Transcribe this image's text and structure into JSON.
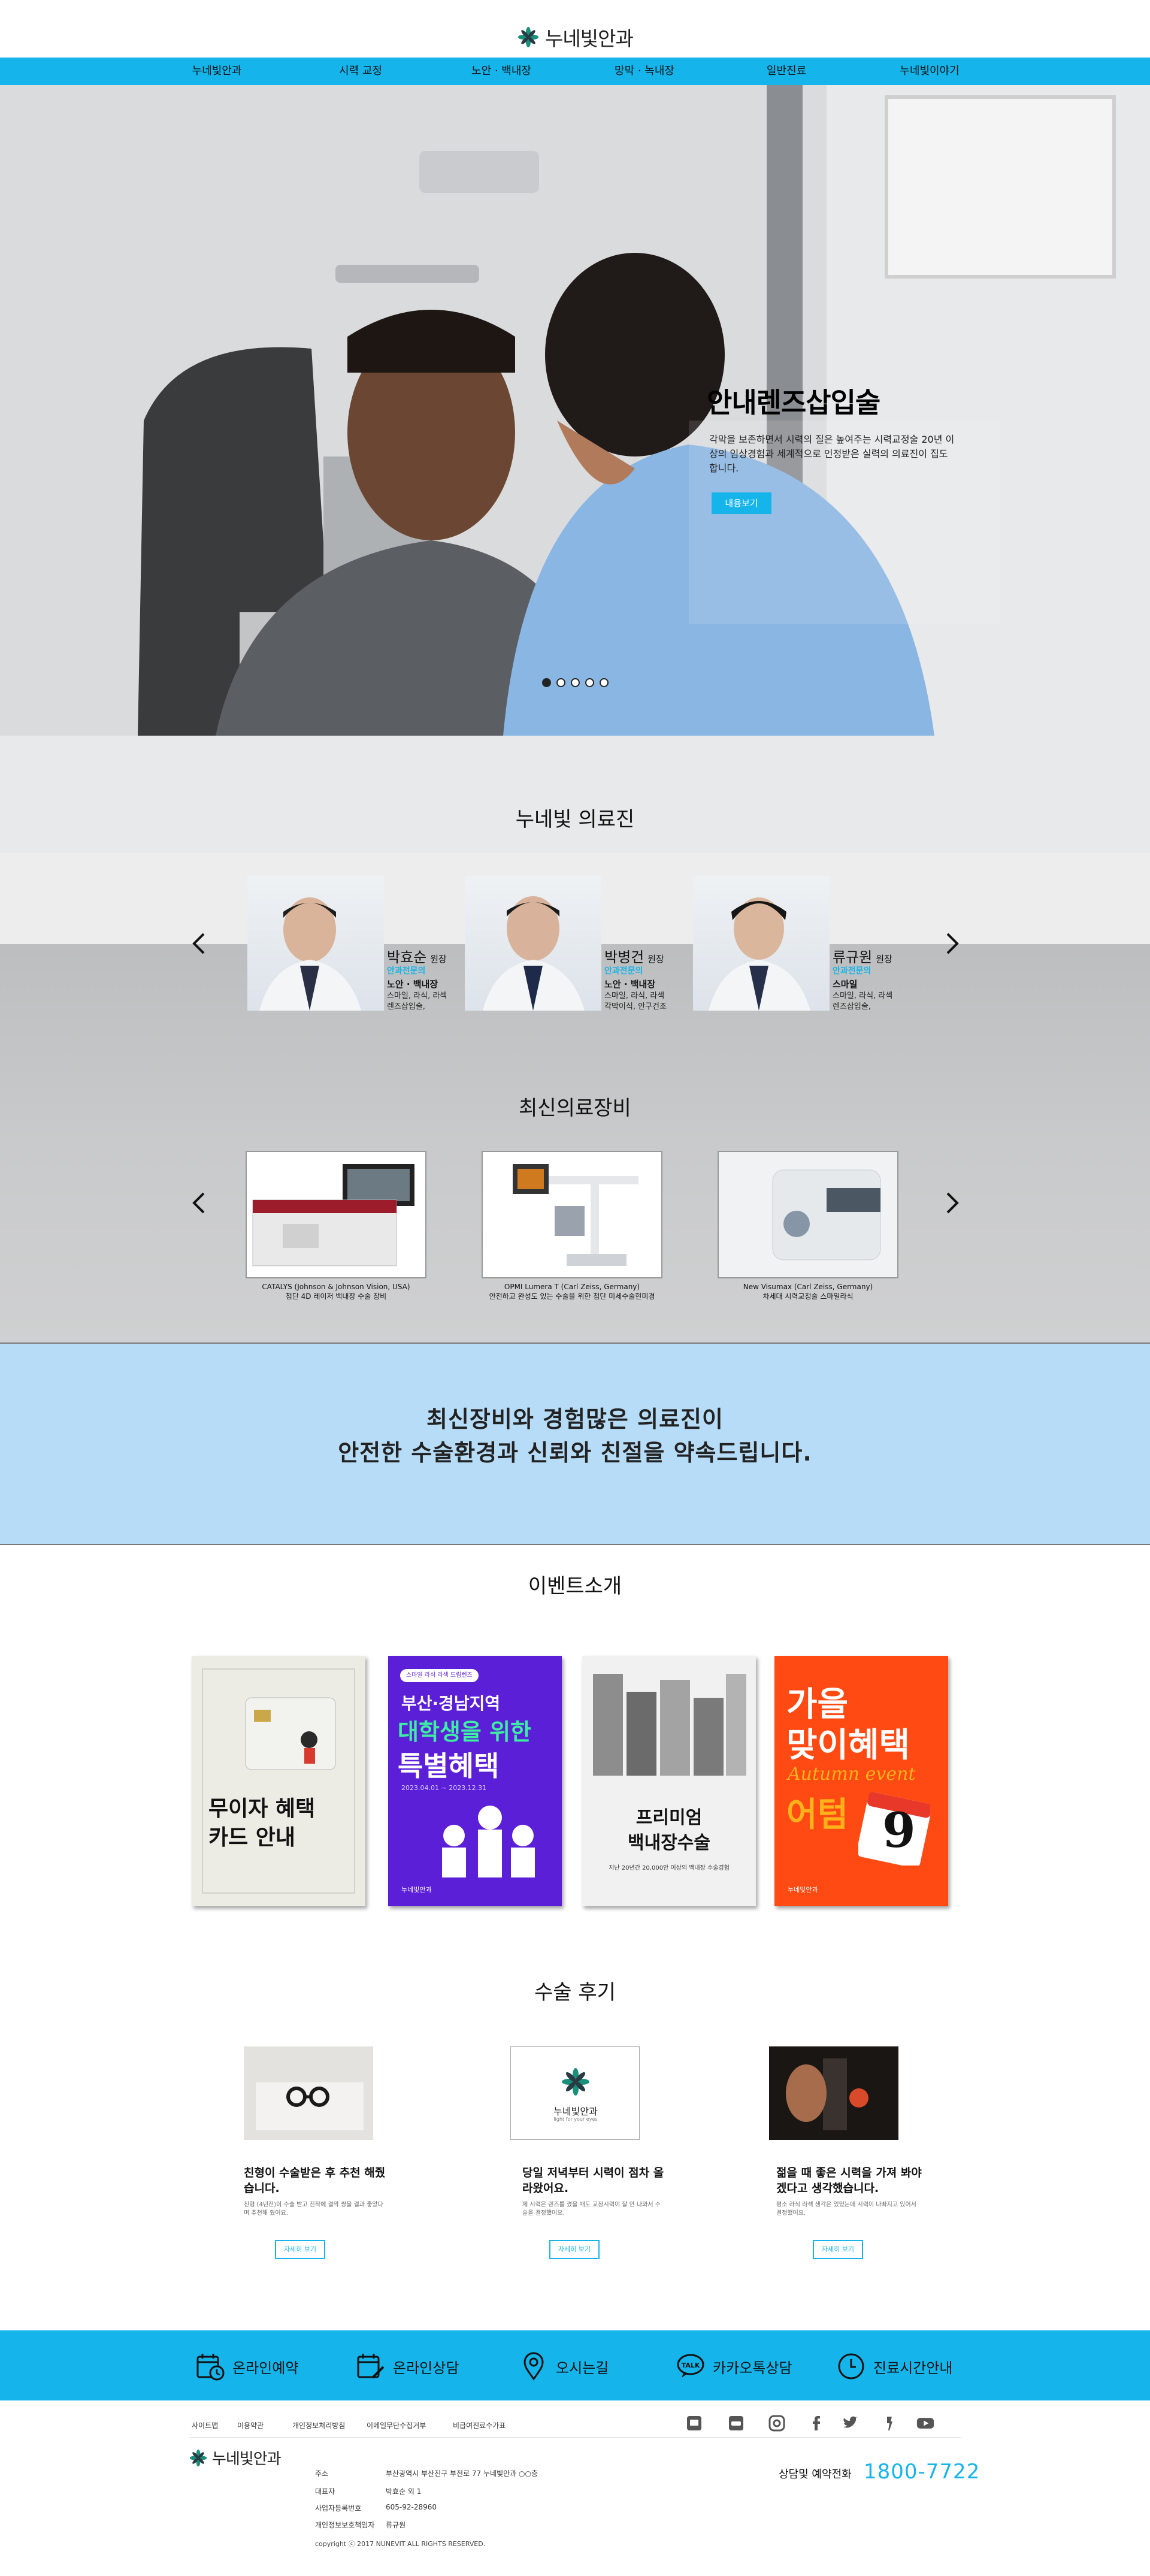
{
  "brand": {
    "name": "누네빛안과",
    "tagline": "light for your eyes",
    "accent": "#15b4ea"
  },
  "nav": [
    "누네빛안과",
    "시력 교정",
    "노안 · 백내장",
    "망막 · 녹내장",
    "일반진료",
    "누네빛이야기"
  ],
  "hero": {
    "title": "안내렌즈삽입술",
    "description": "각막을 보존하면서 시력의 질은 높여주는 시력교정술 20년 이상의 임상경험과 세계적으로 인정받은 실력의 의료진이 집도합니다.",
    "button": "내용보기",
    "slides": 5,
    "active_slide": 1
  },
  "doctors": {
    "title": "누네빛 의료진",
    "items": [
      {
        "name": "박효순",
        "role": "원장",
        "tag": "안과전문의",
        "spec": "노안 · 백내장",
        "desc": "스마일, 라식, 라섹 렌즈삽입술,"
      },
      {
        "name": "박병건",
        "role": "원장",
        "tag": "안과전문의",
        "spec": "노안 · 백내장",
        "desc": "스마일, 라식, 라섹 각막이식, 안구건조"
      },
      {
        "name": "류규원",
        "role": "원장",
        "tag": "안과전문의",
        "spec": "스마일",
        "desc": "스마일, 라식, 라섹 렌즈삽입술,"
      }
    ]
  },
  "equipment": {
    "title": "최신의료장비",
    "items": [
      {
        "name": "CATALYS (Johnson & Johnson Vision, USA)",
        "caption": "첨단 4D 레이저 백내장 수술 장비"
      },
      {
        "name": "OPMI Lumera T (Carl Zeiss, Germany)",
        "caption": "안전하고 완성도 있는 수술을 위한 첨단 미세수술현미경"
      },
      {
        "name": "New Visumax (Carl Zeiss, Germany)",
        "caption": "차세대 시력교정술 스마일라식"
      }
    ]
  },
  "banner": {
    "line1": "최신장비와 경험많은 의료진이",
    "line2": "안전한 수술환경과 신뢰와 친절을 약속드립니다."
  },
  "events": {
    "title": "이벤트소개",
    "cards": [
      {
        "title_line1": "무이자 혜택",
        "title_line2": "카드 안내"
      },
      {
        "top_badge": "스마일 라식 라섹 드림렌즈",
        "line1": "부산·경남지역",
        "line2": "대학생을 위한",
        "line3": "특별혜택",
        "period": "2023.04.01 ~ 2023.12.31",
        "logo": "누네빛안과"
      },
      {
        "line1": "프리미엄",
        "line2": "백내장수술",
        "note": "지난 20년간 20,000안 이상의 백내장 수술경험"
      },
      {
        "line1": "가을",
        "line2": "맞이혜택",
        "script": "Autumn event",
        "line3": "어텀",
        "big_num": "9",
        "logo": "누네빛안과"
      }
    ]
  },
  "reviews": {
    "title": "수술 후기",
    "button": "자세히 보기",
    "items": [
      {
        "head": "친형이 수술받은 후 추천 해줬습니다.",
        "body": "친형 (4년전)이 수술 받고 진작에 결막 쌍을 결과 좋았다며 추천해 줬어요."
      },
      {
        "head": "당일 저녁부터 시력이 점차 올라왔어요.",
        "body": "제 시력은 렌즈를 꼈을 때도 교정시력이 잘 안 나와서 수술을 결정했어요."
      },
      {
        "head": "젊을 때 좋은 시력을 가져 봐야겠다고 생각했습니다.",
        "body": "평소 라식 라섹 생각은 있었는데 시력이 나빠지고 있어서 결정했어요."
      }
    ]
  },
  "quick_links": [
    "온라인예약",
    "온라인상담",
    "오시는길",
    "카카오톡상담",
    "진료시간안내"
  ],
  "footer": {
    "links": [
      "사이트맵",
      "이용약관",
      "개인정보처리방침",
      "이메일무단수집거부",
      "비급여진료수가표"
    ],
    "info": [
      {
        "k": "주소",
        "v": "부산광역시 부산진구 부전로 77 누네빛안과 ○○층"
      },
      {
        "k": "대표자",
        "v": "박효순 외 1"
      },
      {
        "k": "사업자등록번호",
        "v": "605-92-28960"
      },
      {
        "k": "개인정보보호책임자",
        "v": "류규원"
      }
    ],
    "copyright": "copyright ⓒ 2017 NUNEVIT ALL RIGHTS RESERVED.",
    "phone_label": "상담및 예약전화",
    "phone": "1800-7722",
    "social_icons": [
      "blog-icon",
      "cafe-icon",
      "instagram-icon",
      "facebook-icon",
      "twitter-icon",
      "kakaostory-icon",
      "youtube-icon"
    ]
  }
}
